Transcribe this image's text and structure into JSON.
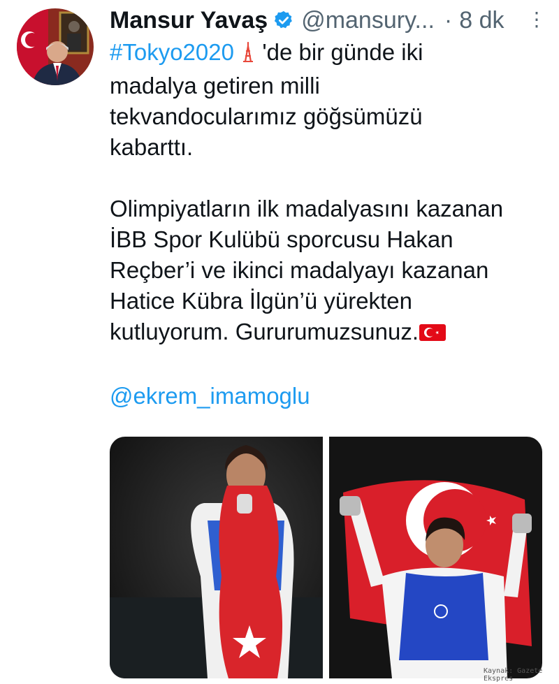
{
  "author": {
    "name": "Mansur Yavaş",
    "handle": "@mansury...",
    "separator": "·",
    "time": "8 dk",
    "verified": true,
    "avatar_icon": "profile-photo"
  },
  "tweet": {
    "hashtag": "#Tokyo2020",
    "hashtag_emoji": "tokyo-tower-emoji",
    "line1_rest": " 'de bir günde iki",
    "line2": "madalya getiren milli",
    "line3": "tekvandocularımız göğsümüzü",
    "line4": "kabarttı.",
    "line5": "Olimpiyatların ilk madalyasını kazanan",
    "line6": "İBB Spor Kulübü sporcusu Hakan",
    "line7": "Reçber’i ve ikinci madalyayı kazanan",
    "line8": "Hatice Kübra İlgün’ü yürekten",
    "line9": "kutluyorum. Gururumuzsunuz.",
    "flag_emoji": "turkey-flag-emoji",
    "mention": "@ekrem_imamoglu"
  },
  "media": {
    "photos": [
      "athlete-with-flag-photo-left",
      "athlete-with-flag-photo-right"
    ]
  },
  "watermark": "Kaynak: Gazete Ekspres",
  "colors": {
    "link": "#1d9bf0",
    "text": "#0f1419",
    "muted": "#536471",
    "flag_red": "#e30a17"
  }
}
